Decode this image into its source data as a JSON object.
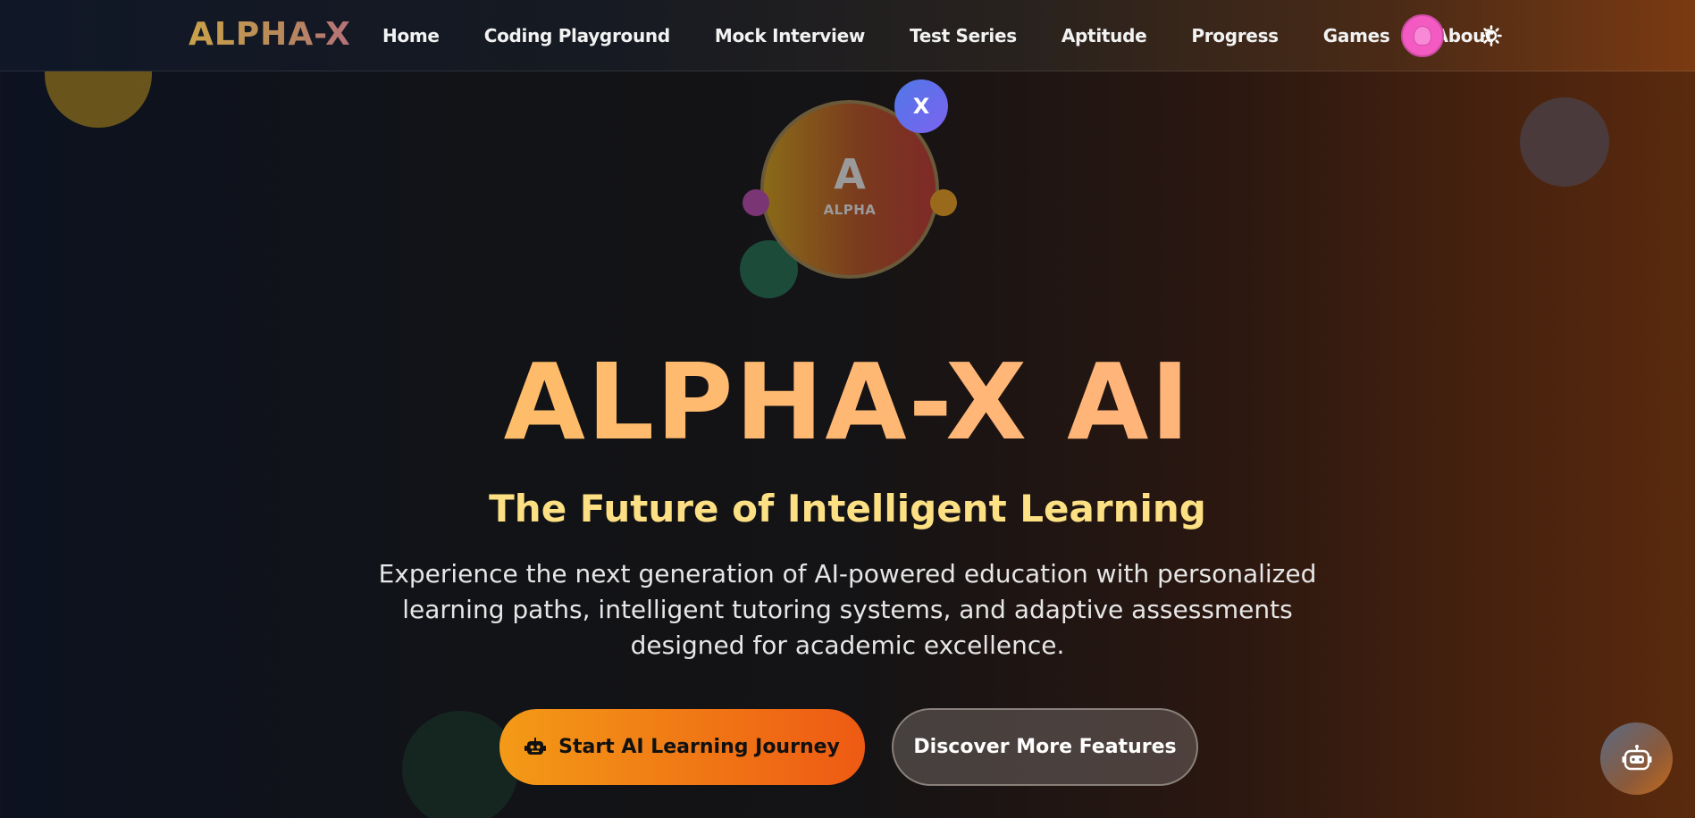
{
  "brand": {
    "name": "ALPHA-X"
  },
  "nav": {
    "items": [
      {
        "label": "Home"
      },
      {
        "label": "Coding Playground"
      },
      {
        "label": "Mock Interview"
      },
      {
        "label": "Test Series"
      },
      {
        "label": "Aptitude"
      },
      {
        "label": "Progress"
      },
      {
        "label": "Games"
      },
      {
        "label": "About"
      }
    ],
    "avatar_icon": "user-avatar-icon",
    "theme_icon": "sun-icon"
  },
  "logo_orb": {
    "letter": "A",
    "label": "ALPHA",
    "badge": "X"
  },
  "hero": {
    "title": "ALPHA-X AI",
    "subtitle": "The Future of Intelligent Learning",
    "description": "Experience the next generation of AI-powered education with personalized learning paths, intelligent tutoring systems, and adaptive assessments designed for academic excellence."
  },
  "actions": {
    "primary_label": "Start AI Learning Journey",
    "primary_icon": "robot-icon",
    "secondary_label": "Discover More Features"
  },
  "chat": {
    "icon": "chatbot-icon"
  },
  "colors": {
    "accent_orange": "#ee5a13",
    "accent_yellow": "#fbc45a",
    "subtitle_yellow": "#fde083",
    "badge_blue": "#4f78e6",
    "avatar_pink": "#f45bc2"
  }
}
